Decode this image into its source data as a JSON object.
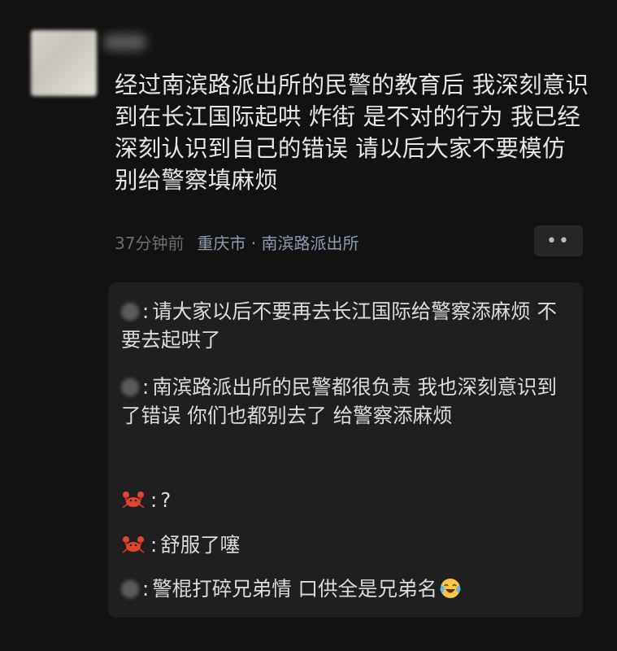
{
  "post": {
    "text": "经过南滨路派出所的民警的教育后 我深刻意识到在长江国际起哄 炸街 是不对的行为 我已经深刻认识到自己的错误 请以后大家不要模仿 别给警察填麻烦",
    "time": "37分钟前",
    "location": "重庆市 · 南滨路派出所",
    "more_label": "••"
  },
  "replies": [
    {
      "avatar": "blurred-avatar",
      "text": "请大家以后不要再去长江国际给警察添麻烦 不要去起哄了"
    },
    {
      "avatar": "blurred-avatar",
      "text": "南滨路派出所的民警都很负责 我也深刻意识到了错误 你们也都别去了 给警察添麻烦"
    },
    {
      "avatar": "crab-icon",
      "text": "?"
    },
    {
      "avatar": "crab-icon",
      "text": "舒服了噻"
    },
    {
      "avatar": "blurred-avatar",
      "text": "警棍打碎兄弟情 口供全是兄弟名",
      "trailing_icon": "laughing-crying-emoji-icon"
    }
  ],
  "colors": {
    "background": "#121212",
    "text": "#e6e6e6",
    "meta": "#6d6d6d",
    "location": "#8c9db3",
    "reply_bg": "#1f1f1f"
  }
}
